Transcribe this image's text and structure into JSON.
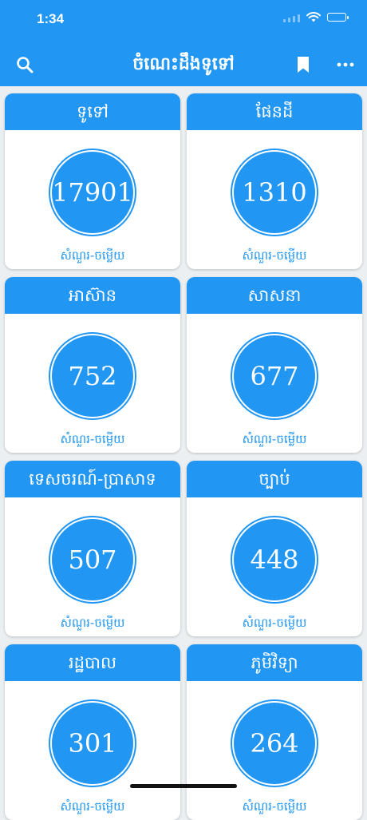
{
  "status_bar": {
    "time": "1:34"
  },
  "app_bar": {
    "title": "ចំណេះដឹងទូទៅ"
  },
  "accent_color": "#2196f3",
  "categories": [
    {
      "title": "ទូទៅ",
      "count": "17901",
      "subtitle": "សំណួរ-ចម្លើយ"
    },
    {
      "title": "ផែនដី",
      "count": "1310",
      "subtitle": "សំណួរ-ចម្លើយ"
    },
    {
      "title": "អាស៊ាន",
      "count": "752",
      "subtitle": "សំណួរ-ចម្លើយ"
    },
    {
      "title": "សាសនា",
      "count": "677",
      "subtitle": "សំណួរ-ចម្លើយ"
    },
    {
      "title": "ទេសចរណ៍-ប្រាសាទ",
      "count": "507",
      "subtitle": "សំណួរ-ចម្លើយ"
    },
    {
      "title": "ច្បាប់",
      "count": "448",
      "subtitle": "សំណួរ-ចម្លើយ"
    },
    {
      "title": "រដ្ឋបាល",
      "count": "301",
      "subtitle": "សំណួរ-ចម្លើយ"
    },
    {
      "title": "ភូមិវិទ្យា",
      "count": "264",
      "subtitle": "សំណួរ-ចម្លើយ"
    }
  ]
}
